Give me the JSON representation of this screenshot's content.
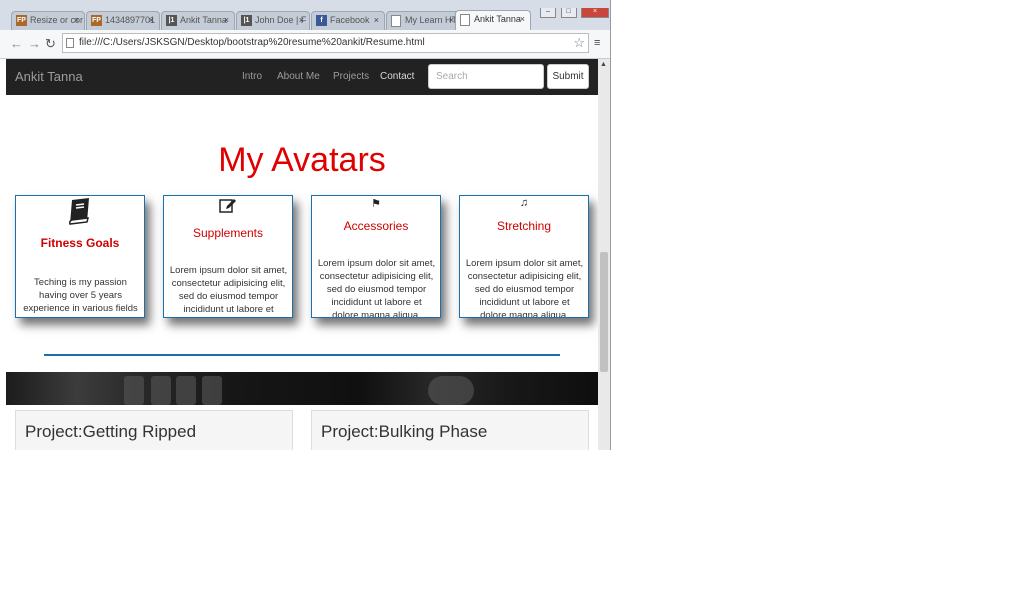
{
  "browser": {
    "tabs": [
      {
        "label": "Resize or cor",
        "favicon": "FP"
      },
      {
        "label": "1434897701",
        "favicon": "FP"
      },
      {
        "label": "Ankit Tanna",
        "favicon": "|1"
      },
      {
        "label": "John Doe | F",
        "favicon": "|1"
      },
      {
        "label": "Facebook",
        "favicon": "f"
      },
      {
        "label": "My Learn HT",
        "favicon": ""
      },
      {
        "label": "Ankit Tanna",
        "favicon": ""
      }
    ],
    "active_tab_index": 6,
    "url": "file:///C:/Users/JSKSGN/Desktop/bootstrap%20resume%20ankit/Resume.html",
    "window_buttons": {
      "minimize": "–",
      "maximize": "□",
      "close": "×"
    },
    "tab_close": "×"
  },
  "navbar": {
    "brand": "Ankit Tanna",
    "links": [
      "Intro",
      "About Me",
      "Projects",
      "Contact"
    ],
    "search_placeholder": "Search",
    "submit_label": "Submit"
  },
  "avatars": {
    "heading": "My Avatars",
    "cards": [
      {
        "icon": "book-icon",
        "title": "Fitness Goals",
        "desc": "Teching is my passion having over 5 years experience in various fields"
      },
      {
        "icon": "edit-icon",
        "title": "Supplements",
        "desc": "Lorem ipsum dolor sit amet, consectetur adipisicing elit, sed do eiusmod tempor incididunt ut labore et dolore magna aliqua."
      },
      {
        "icon": "flag-icon",
        "title": "Accessories",
        "desc": "Lorem ipsum dolor sit amet, consectetur adipisicing elit, sed do eiusmod tempor incididunt ut labore et dolore magna aliqua."
      },
      {
        "icon": "music-icon",
        "title": "Stretching",
        "desc": "Lorem ipsum dolor sit amet, consectetur adipisicing elit, sed do eiusmod tempor incididunt ut labore et dolore magna aliqua."
      }
    ]
  },
  "projects": [
    {
      "title": "Project:Getting Ripped"
    },
    {
      "title": "Project:Bulking Phase"
    }
  ],
  "colors": {
    "accent_red": "#e00000",
    "card_border": "#1a6fad",
    "navbar_bg": "#222222"
  }
}
